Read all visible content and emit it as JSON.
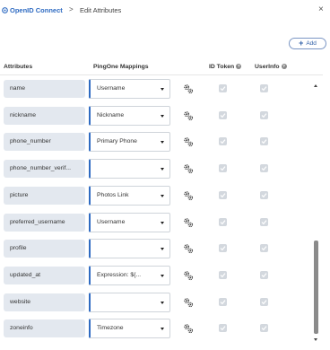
{
  "breadcrumb": {
    "app": "OpenID Connect",
    "separator": ">",
    "page": "Edit Attributes"
  },
  "close_label": "×",
  "add_button": {
    "label": "Add"
  },
  "columns": {
    "attributes": "Attributes",
    "mappings": "PingOne Mappings",
    "id_token": "ID Token",
    "userinfo": "UserInfo",
    "help": "?"
  },
  "rows": [
    {
      "attribute": "name",
      "mapping": "Username",
      "id_token": true,
      "userinfo": true
    },
    {
      "attribute": "nickname",
      "mapping": "Nickname",
      "id_token": true,
      "userinfo": true
    },
    {
      "attribute": "phone_number",
      "mapping": "Primary Phone",
      "id_token": true,
      "userinfo": true
    },
    {
      "attribute": "phone_number_verif...",
      "mapping": "",
      "id_token": true,
      "userinfo": true
    },
    {
      "attribute": "picture",
      "mapping": "Photos Link",
      "id_token": true,
      "userinfo": true
    },
    {
      "attribute": "preferred_username",
      "mapping": "Username",
      "id_token": true,
      "userinfo": true
    },
    {
      "attribute": "profile",
      "mapping": "",
      "id_token": true,
      "userinfo": true
    },
    {
      "attribute": "updated_at",
      "mapping": "Expression: ${...",
      "id_token": true,
      "userinfo": true
    },
    {
      "attribute": "website",
      "mapping": "",
      "id_token": true,
      "userinfo": true
    },
    {
      "attribute": "zoneinfo",
      "mapping": "Timezone",
      "id_token": true,
      "userinfo": true
    }
  ],
  "colors": {
    "accent": "#2f6bc2",
    "attr_bg": "#e3e8ef",
    "checkbox_bg": "#d3d8de",
    "scroll_thumb": "#8b8b8b"
  },
  "icons": {
    "app": "openid-app-icon",
    "row_action": "gear-cog-icon",
    "checkbox": "check-icon"
  }
}
